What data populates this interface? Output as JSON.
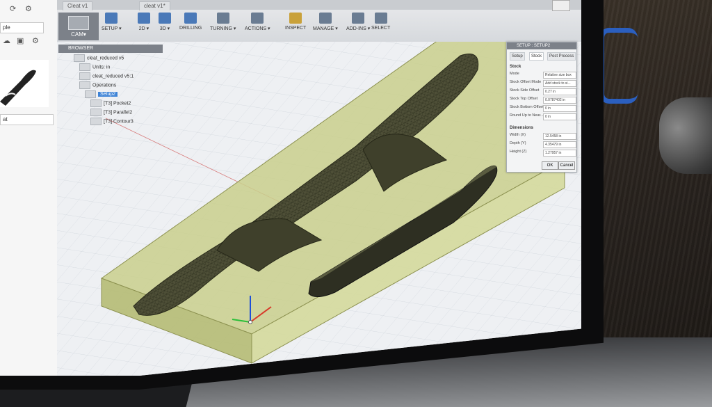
{
  "document_tabs": [
    "Cleat v1",
    "cleat v1*"
  ],
  "left_panel": {
    "search_partial": "ple",
    "thumbnail_caption": "at"
  },
  "workspace_button": "CAM▾",
  "ribbon": [
    {
      "label": "SETUP ▾",
      "color": "#4a79b8"
    },
    {
      "label": "2D ▾",
      "color": "#4a79b8"
    },
    {
      "label": "3D ▾",
      "color": "#4a79b8"
    },
    {
      "label": "DRILLING",
      "color": "#4a79b8"
    },
    {
      "label": "TURNING ▾",
      "color": "#6a7c92"
    },
    {
      "label": "ACTIONS ▾",
      "color": "#6a7c92"
    },
    {
      "label": "INSPECT",
      "color": "#c9a13a"
    },
    {
      "label": "MANAGE ▾",
      "color": "#6a7c92"
    },
    {
      "label": "ADD-INS ▾",
      "color": "#6a7c92"
    },
    {
      "label": "SELECT",
      "color": "#6a7c92"
    }
  ],
  "browser": {
    "title": "BROWSER",
    "items": [
      {
        "label": "cleat_reduced v5",
        "depth": 0
      },
      {
        "label": "Units: in",
        "depth": 1
      },
      {
        "label": "cleat_reduced v5:1",
        "depth": 1
      },
      {
        "label": "Operations",
        "depth": 1
      },
      {
        "label": "Setup2",
        "depth": 2,
        "selected": true
      },
      {
        "label": "[T3] Pocket2",
        "depth": 3
      },
      {
        "label": "[T3] Parallel2",
        "depth": 3
      },
      {
        "label": "[T3] Contour3",
        "depth": 3
      }
    ]
  },
  "dialog": {
    "title": "SETUP : SETUP2",
    "tabs": [
      "Setup",
      "Stock",
      "Post Process"
    ],
    "stock_section": "Stock",
    "stock_rows": [
      {
        "label": "Mode",
        "value": "Relative size box"
      },
      {
        "label": "Stock Offset Mode",
        "value": "Add stock to si..."
      },
      {
        "label": "Stock Side Offset",
        "value": "0.27 in"
      },
      {
        "label": "Stock Top Offset",
        "value": "0.0787402 in"
      },
      {
        "label": "Stock Bottom Offset",
        "value": "0 in"
      },
      {
        "label": "Round Up to Near...",
        "value": "0 in"
      }
    ],
    "dimensions_section": "Dimensions",
    "dimension_rows": [
      {
        "label": "Width (X)",
        "value": "12.5458 in"
      },
      {
        "label": "Depth (Y)",
        "value": "4.35479 in"
      },
      {
        "label": "Height (Z)",
        "value": "1.27957 in"
      }
    ],
    "ok": "OK",
    "cancel": "Cancel"
  },
  "colors": {
    "stock": "#c9cf8c",
    "model": "#4e4f37",
    "selection": "#3d83d6"
  }
}
